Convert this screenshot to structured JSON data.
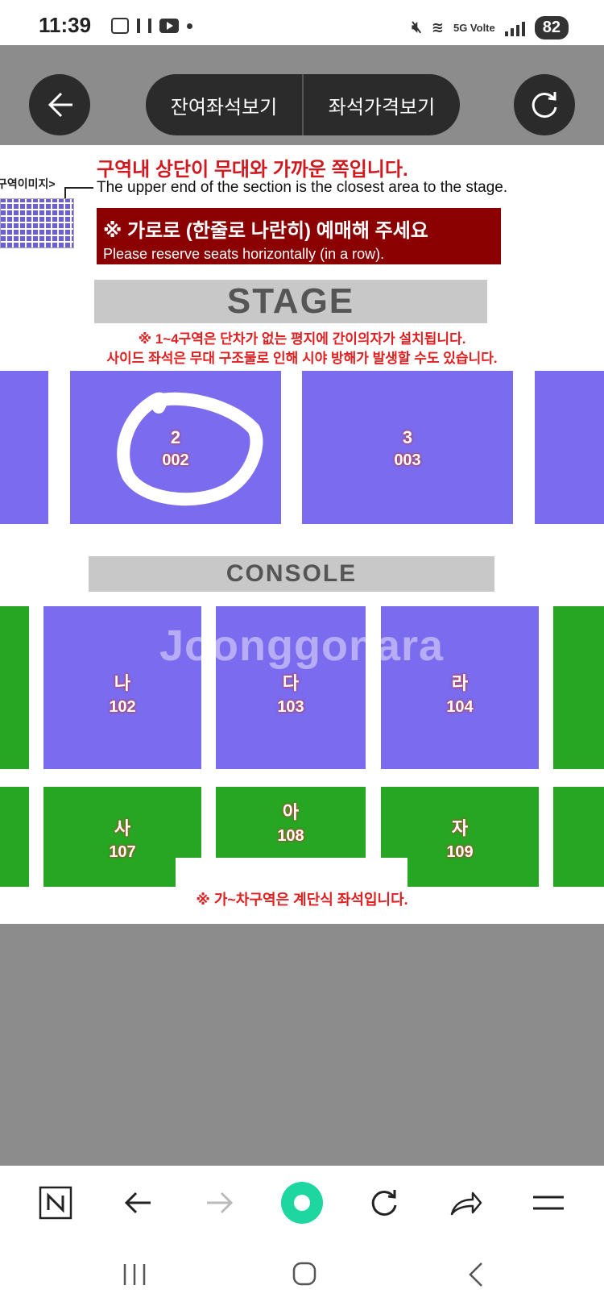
{
  "status": {
    "time": "11:39",
    "battery": "82",
    "network": "5G Volte"
  },
  "toolbar": {
    "remaining_seats": "잔여좌석보기",
    "seat_prices": "좌석가격보기"
  },
  "notices": {
    "stage_direction_ko": "구역내 상단이 무대와 가까운 쪽입니다.",
    "stage_direction_en": "The upper end of the section is the closest area to the stage.",
    "reserve_ko": "※ 가로로 (한줄로 나란히) 예매해 주세요",
    "reserve_en": "Please reserve seats horizontally (in a row).",
    "legend_label": "구역이미지>",
    "floor_note_1": "※ 1~4구역은 단차가 없는 평지에 간이의자가 설치됩니다.",
    "floor_note_2": "사이드 좌석은 무대 구조물로 인해 시야 방해가 발생할 수도 있습니다.",
    "tier_note": "※ 가~차구역은 계단식 좌석입니다."
  },
  "stage_label": "STAGE",
  "console_label": "CONSOLE",
  "watermark": "Joonggonara",
  "sections": {
    "s2": {
      "name": "2",
      "code": "002"
    },
    "s3": {
      "name": "3",
      "code": "003"
    },
    "s102": {
      "name": "나",
      "code": "102"
    },
    "s103": {
      "name": "다",
      "code": "103"
    },
    "s104": {
      "name": "라",
      "code": "104"
    },
    "s107": {
      "name": "사",
      "code": "107"
    },
    "s108": {
      "name": "아",
      "code": "108"
    },
    "s109": {
      "name": "자",
      "code": "109"
    }
  },
  "colors": {
    "floor_section": "#7b6bee",
    "tier_section": "#27a623",
    "notice_red": "#e02020",
    "reserve_banner": "#8b0000",
    "toolbar_bg": "#8c8c8c",
    "button_bg": "#2b2b2b",
    "browser_accent": "#1ed6a0"
  },
  "icons": {
    "back": "arrow-left-icon",
    "refresh": "refresh-icon",
    "browser_home": "naver-n-icon",
    "nav_back": "arrow-left-icon",
    "nav_forward": "arrow-right-icon",
    "green_dot": "green-dot-icon",
    "nav_refresh": "refresh-icon",
    "share": "share-icon",
    "menu": "menu-icon"
  }
}
